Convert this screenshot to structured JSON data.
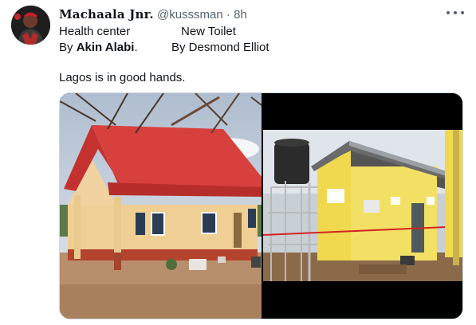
{
  "tweet": {
    "display_name": "Machaala Jnr.",
    "handle": "@kusssman",
    "separator": "·",
    "time": "8h",
    "line1_left": "Health center",
    "line1_right": "New Toilet",
    "line2_left_prefix": "By ",
    "line2_left_name": "Akin Alabi",
    "line2_left_suffix": ".",
    "line2_right": "By Desmond Elliot",
    "line3": "Lagos is in good hands."
  },
  "icons": {
    "more": "more-horizontal-icon"
  },
  "colors": {
    "text_primary": "#0f1419",
    "text_secondary": "#536471",
    "roof_red": "#d8403e",
    "wall_yellow": "#f2e064"
  }
}
